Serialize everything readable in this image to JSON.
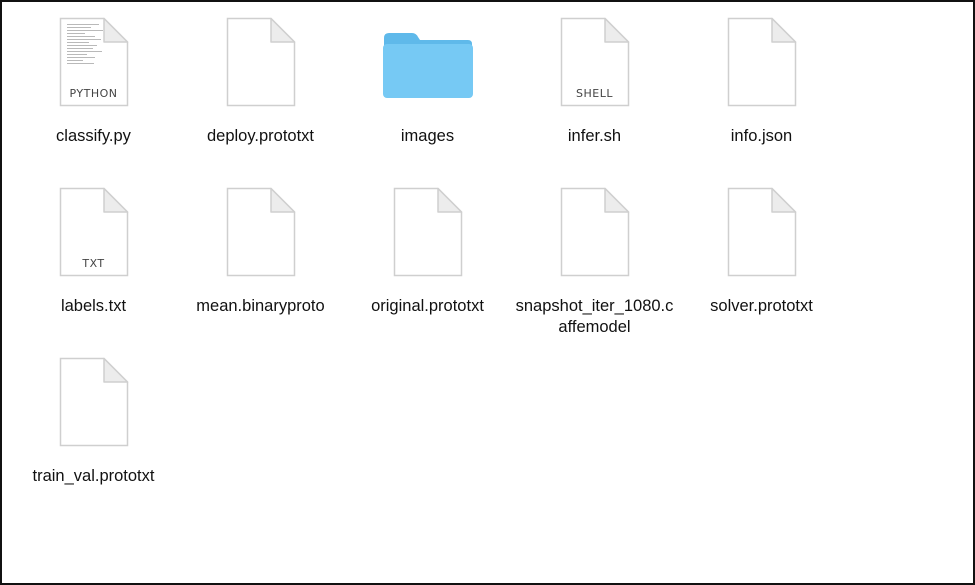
{
  "files": [
    {
      "name": "classify.py",
      "kind": "document",
      "tag": "PYTHON",
      "icon": "python-file-icon"
    },
    {
      "name": "deploy.prototxt",
      "kind": "document",
      "tag": "",
      "icon": "document-icon"
    },
    {
      "name": "images",
      "kind": "folder",
      "tag": "",
      "icon": "folder-icon"
    },
    {
      "name": "infer.sh",
      "kind": "document",
      "tag": "SHELL",
      "icon": "shell-file-icon"
    },
    {
      "name": "info.json",
      "kind": "document",
      "tag": "",
      "icon": "document-icon"
    },
    {
      "name": "labels.txt",
      "kind": "document",
      "tag": "TXT",
      "icon": "text-file-icon"
    },
    {
      "name": "mean.binaryproto",
      "kind": "document",
      "tag": "",
      "icon": "document-icon"
    },
    {
      "name": "original.prototxt",
      "kind": "document",
      "tag": "",
      "icon": "document-icon"
    },
    {
      "name": "snapshot_iter_1080.caffemodel",
      "kind": "document",
      "tag": "",
      "icon": "document-icon"
    },
    {
      "name": "solver.prototxt",
      "kind": "document",
      "tag": "",
      "icon": "document-icon"
    },
    {
      "name": "train_val.prototxt",
      "kind": "document",
      "tag": "",
      "icon": "document-icon"
    }
  ],
  "colors": {
    "folder_body": "#76c9f4",
    "folder_tab": "#5fb9ea",
    "page_fill": "#ffffff",
    "page_stroke": "#cfcfcf",
    "fold_fill": "#ececec"
  }
}
